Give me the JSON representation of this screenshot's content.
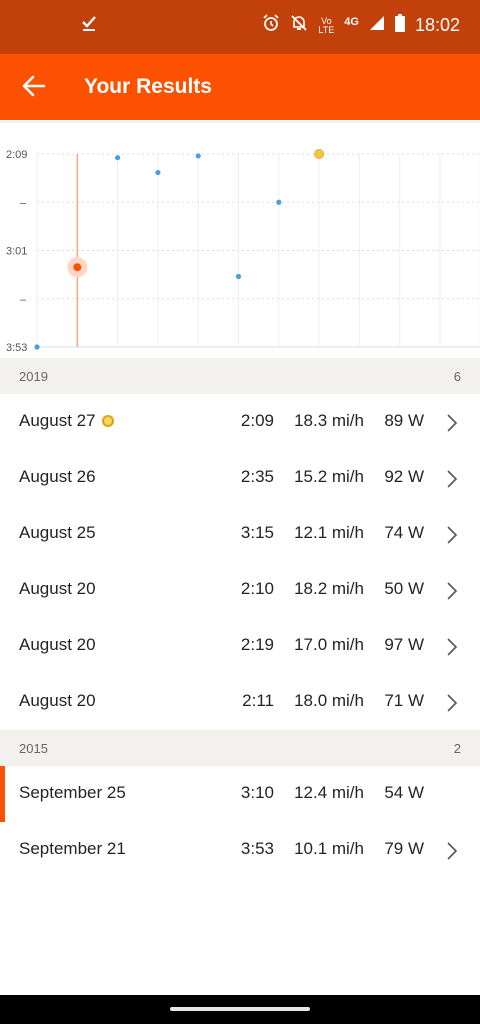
{
  "status_bar": {
    "time": "18:02",
    "network": "4G",
    "icons": [
      "download-done-icon",
      "alarm-icon",
      "notifications-off-icon",
      "volte-icon",
      "signal-icon",
      "battery-icon"
    ]
  },
  "app_bar": {
    "title": "Your Results",
    "back_icon": "arrow-back-icon"
  },
  "colors": {
    "accent": "#fc5200",
    "status": "#c2410a",
    "point": "#4a9fe0",
    "selected": "#fc5200",
    "pr_gold": "#f5c542"
  },
  "chart_data": {
    "type": "scatter",
    "y_tick_labels": [
      "2:09",
      "–",
      "3:01",
      "–",
      "3:53"
    ],
    "y_inverted": true,
    "grid": true,
    "points": [
      {
        "label": "September 21",
        "time": "3:53",
        "seconds": 233,
        "kind": "normal"
      },
      {
        "label": "September 25",
        "time": "3:10",
        "seconds": 190,
        "kind": "selected"
      },
      {
        "label": "August 20",
        "time": "2:11",
        "seconds": 131,
        "kind": "normal"
      },
      {
        "label": "August 20",
        "time": "2:19",
        "seconds": 139,
        "kind": "normal"
      },
      {
        "label": "August 20",
        "time": "2:10",
        "seconds": 130,
        "kind": "normal"
      },
      {
        "label": "August 25",
        "time": "3:15",
        "seconds": 195,
        "kind": "normal"
      },
      {
        "label": "August 26",
        "time": "2:35",
        "seconds": 155,
        "kind": "normal"
      },
      {
        "label": "August 27",
        "time": "2:09",
        "seconds": 129,
        "kind": "pr"
      }
    ]
  },
  "sections": [
    {
      "year": "2019",
      "count": "6",
      "rows": [
        {
          "date": "August 27",
          "medal": true,
          "time": "2:09",
          "speed": "18.3 mi/h",
          "power": "89 W",
          "chevron": true,
          "selected": false
        },
        {
          "date": "August 26",
          "medal": false,
          "time": "2:35",
          "speed": "15.2 mi/h",
          "power": "92 W",
          "chevron": true,
          "selected": false
        },
        {
          "date": "August 25",
          "medal": false,
          "time": "3:15",
          "speed": "12.1 mi/h",
          "power": "74 W",
          "chevron": true,
          "selected": false
        },
        {
          "date": "August 20",
          "medal": false,
          "time": "2:10",
          "speed": "18.2 mi/h",
          "power": "50 W",
          "chevron": true,
          "selected": false
        },
        {
          "date": "August 20",
          "medal": false,
          "time": "2:19",
          "speed": "17.0 mi/h",
          "power": "97 W",
          "chevron": true,
          "selected": false
        },
        {
          "date": "August 20",
          "medal": false,
          "time": "2:11",
          "speed": "18.0 mi/h",
          "power": "71 W",
          "chevron": true,
          "selected": false
        }
      ]
    },
    {
      "year": "2015",
      "count": "2",
      "rows": [
        {
          "date": "September 25",
          "medal": false,
          "time": "3:10",
          "speed": "12.4 mi/h",
          "power": "54 W",
          "chevron": false,
          "selected": true
        },
        {
          "date": "September 21",
          "medal": false,
          "time": "3:53",
          "speed": "10.1 mi/h",
          "power": "79 W",
          "chevron": true,
          "selected": false
        }
      ]
    }
  ]
}
